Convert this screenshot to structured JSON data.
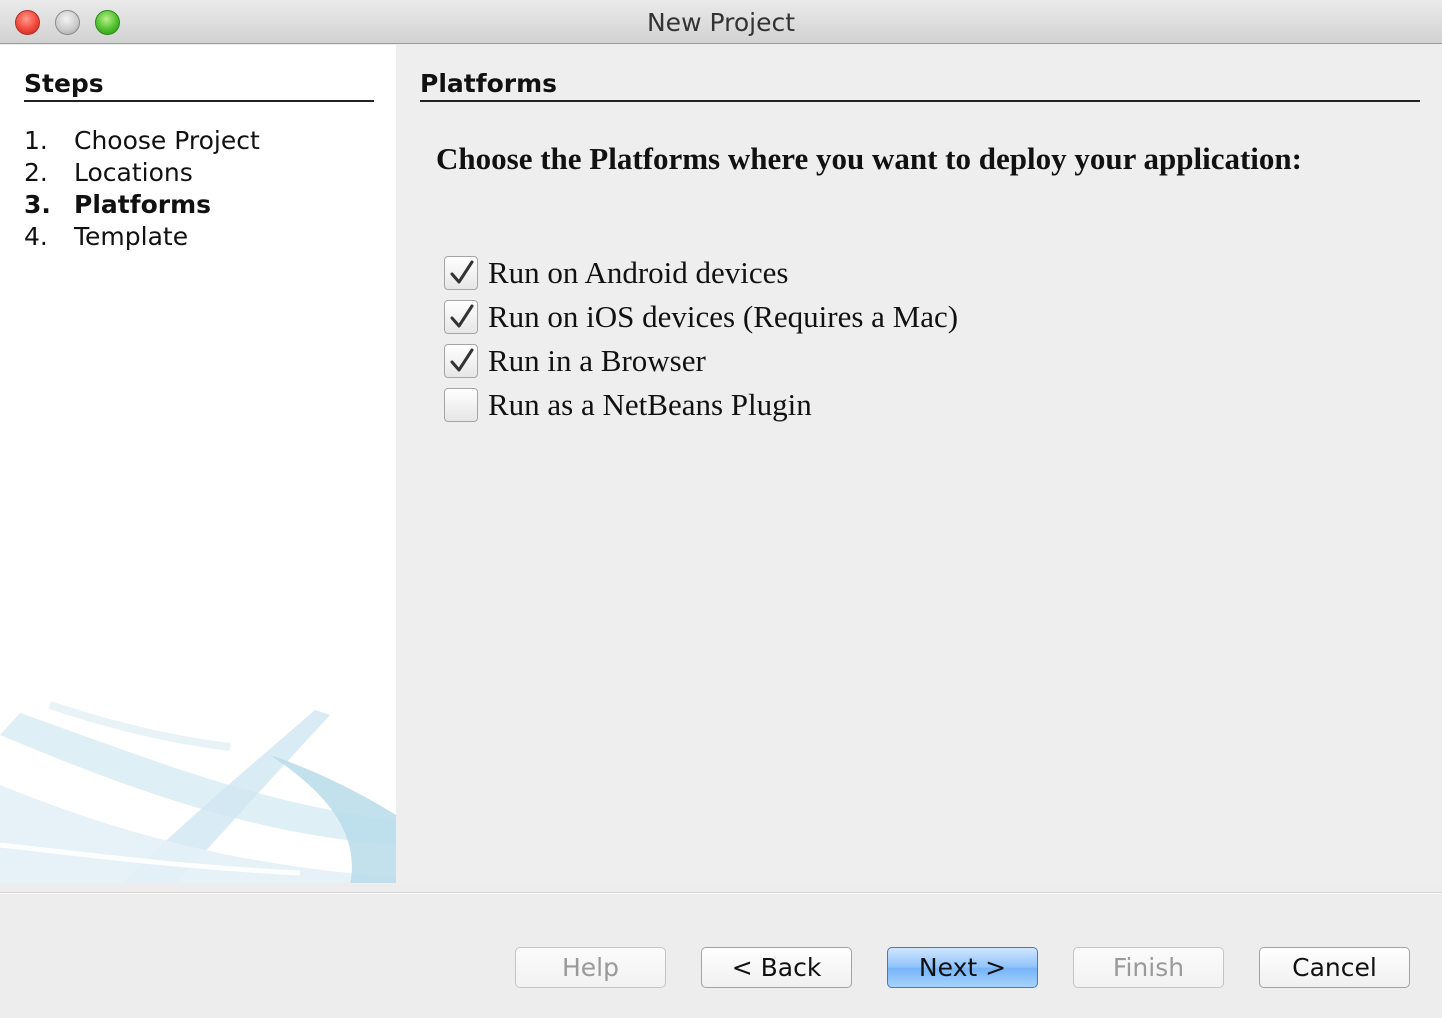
{
  "window": {
    "title": "New Project"
  },
  "steps": {
    "heading": "Steps",
    "items": [
      {
        "num": "1.",
        "label": "Choose Project",
        "current": false
      },
      {
        "num": "2.",
        "label": "Locations",
        "current": false
      },
      {
        "num": "3.",
        "label": "Platforms",
        "current": true
      },
      {
        "num": "4.",
        "label": "Template",
        "current": false
      }
    ]
  },
  "main": {
    "heading": "Platforms",
    "instruction": "Choose the Platforms where you want to deploy your application:",
    "options": [
      {
        "label": "Run on Android devices",
        "checked": true
      },
      {
        "label": "Run on iOS devices (Requires a Mac)",
        "checked": true
      },
      {
        "label": "Run in a Browser",
        "checked": true
      },
      {
        "label": "Run as a NetBeans Plugin",
        "checked": false
      }
    ]
  },
  "buttons": {
    "help": "Help",
    "back": "< Back",
    "next": "Next >",
    "finish": "Finish",
    "cancel": "Cancel"
  },
  "colors": {
    "default_button": "#8ec2fb",
    "panel_background": "#eeeeee",
    "steps_background": "#ffffff"
  }
}
